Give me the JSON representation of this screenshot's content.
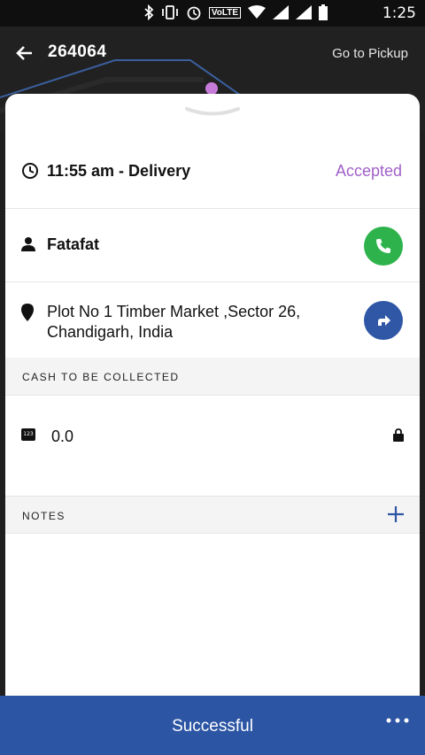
{
  "status_bar": {
    "time": "1:25",
    "volte": "VoLTE",
    "icons": [
      "bluetooth-icon",
      "vibrate-icon",
      "alarm-icon",
      "wifi-icon",
      "signal-icon",
      "signal-icon",
      "battery-icon"
    ]
  },
  "header": {
    "order_id": "264064",
    "go_to_pickup": "Go to Pickup"
  },
  "delivery": {
    "time_label": "11:55 am - Delivery",
    "status": "Accepted"
  },
  "customer": {
    "name": "Fatafat"
  },
  "address": {
    "line1": "Plot No 1 Timber Market ,Sector 26,",
    "line2": "Chandigarh, India"
  },
  "cash": {
    "section_label": "CASH TO BE COLLECTED",
    "value": "0.0",
    "icon_text": "123"
  },
  "notes": {
    "section_label": "NOTES"
  },
  "footer": {
    "button_label": "Successful"
  },
  "colors": {
    "accent_purple": "#a160c8",
    "call_green": "#2eb34c",
    "primary_blue": "#2c55a4"
  }
}
